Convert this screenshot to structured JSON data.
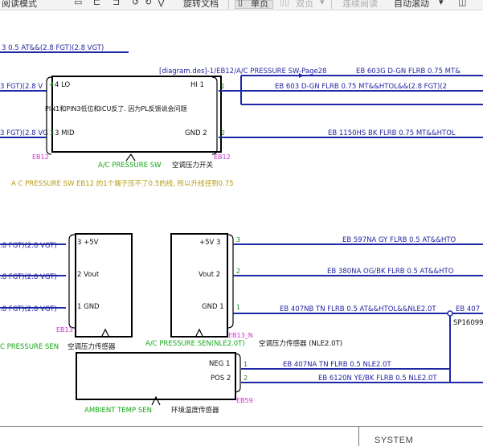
{
  "toolbar": {
    "read_mode": "阅读模式",
    "rotate_doc": "旋转文档",
    "single_page": "单页",
    "double_page": "双页",
    "continuous": "连续阅读",
    "auto_scroll": "自动滚动"
  },
  "diagram": {
    "top_wire": "3  0.5  AT&&(2.8 FGT)(2.8 VGT)",
    "ref_link": "[diagram.des]-1/EB12/A/C PRESSURE SW-Page28",
    "ref_wire": "EB 603G D-GN FLRB 0.75 MT&",
    "sw_out_wire": "EB 603 D-GN FLRB 0.75 MT&&HTOL&&(2.8 FGT)(2",
    "sw_gnd_wire": "EB 1150HS BK FLRB 0.75 MT&&HTOL",
    "left_wire_1": "3 FGT)(2.8 V",
    "left_wire_2": "3 FGT)(2.8 VG",
    "sw_pin_lo": "4  LO",
    "sw_pin_mid": "3  MID",
    "sw_pin_hi": "HI  1",
    "sw_pin_gnd": "GND  2",
    "sw_note": "PIN1和PIN3低位和ICU反了. 因为PL反馈说会问题",
    "sw_pin1": "1",
    "sw_pin2": "2",
    "sw_left4": "4",
    "sw_left3": "3",
    "sw_conn_l": "EB12",
    "sw_conn_r": "EB12",
    "sw_name": "A/C PRESSURE SW",
    "sw_name_cn": "空调压力开关",
    "yellow_note": "A C PRESSURE SW EB12 的1个端子压不了0.5的线, 所以升线径到0.75",
    "sen_left_1": ".8 FGT)(2.8 VGT)",
    "sen_left_2": ".8 FGT)(2.8 VGT)",
    "sen_left_3": ".8 FGT)(2.8 VGT)",
    "sen_pin_5v": "3  +5V",
    "sen_pin_vout": "2  Vout",
    "sen_pin_gnd": "1  GND",
    "sen_conn": "EB13",
    "sen_name": "C PRESSURE SEN",
    "sen_name_cn": "空调压力传感器",
    "nle_pin_5v": "+5V  3",
    "nle_pin_vout": "Vout  2",
    "nle_pin_gnd": "GND 1",
    "nle_num3": "3",
    "nle_num2": "2",
    "nle_num1": "1",
    "nle_wire_5v": "EB 597NA GY FLRB 0.5 AT&&HTO",
    "nle_wire_vout": "EB 380NA OG/BK FLRB 0.5 AT&&HTO",
    "nle_wire_gnd": "EB 407NB TN FLRB 0.5 AT&&HTOL&&NLE2.0T",
    "nle_wire_gnd_r": "EB 407",
    "nle_conn": "EB13_N",
    "nle_name": "A/C PRESSURE SEN(NLE2.0T)",
    "nle_name_cn": "空调压力传感器 (NLE2.0T)",
    "splice": "SP16099",
    "amb_pin_neg": "NEG  1",
    "amb_pin_pos": "POS  2",
    "amb_num1": "1",
    "amb_num2": "2",
    "amb_wire_neg": "EB 407NA TN FLRB 0.5 NLE2.0T",
    "amb_wire_pos": "EB 6120N YE/BK FLRB 0.5 NLE2.0T",
    "amb_conn": "EB59",
    "amb_name": "AMBIENT TEMP SEN",
    "amb_name_cn": "环境温度传感器"
  },
  "footer": {
    "system": "SYSTEM"
  }
}
